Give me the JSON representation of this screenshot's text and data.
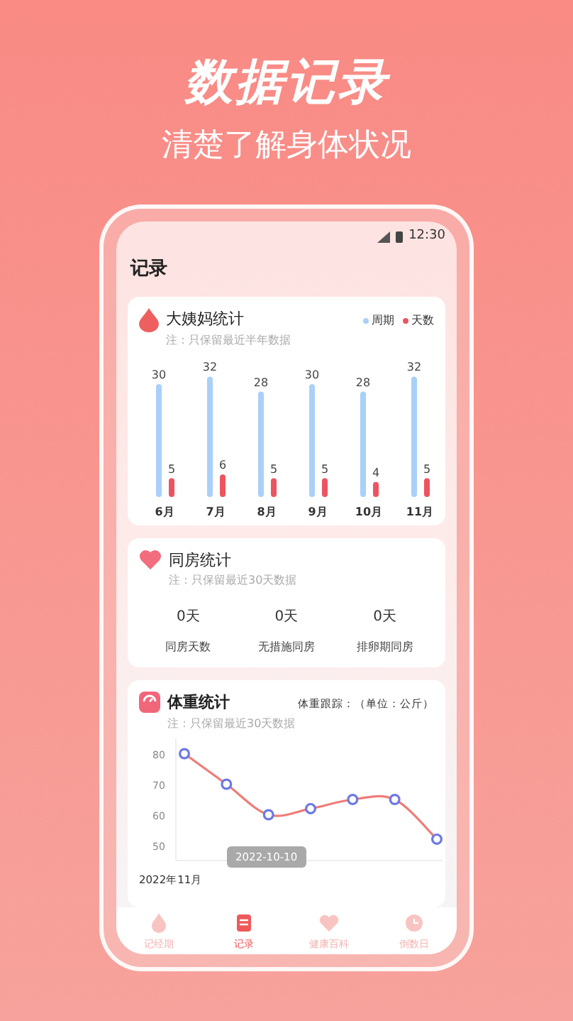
{
  "promo": {
    "headline": "数据记录",
    "subtitle": "清楚了解身体状况"
  },
  "status_bar": {
    "time": "12:30"
  },
  "page_title": "记录",
  "period_card": {
    "title": "大姨妈统计",
    "note": "注：只保留最近半年数据",
    "chart_data": {
      "type": "bar",
      "categories": [
        "6月",
        "7月",
        "8月",
        "9月",
        "10月",
        "11月"
      ],
      "data_labels": true,
      "series": [
        {
          "name": "周期",
          "color": "#a9d0f8",
          "values": [
            30,
            32,
            28,
            30,
            28,
            32
          ]
        },
        {
          "name": "天数",
          "color": "#ec5560",
          "values": [
            5,
            6,
            5,
            5,
            4,
            5
          ]
        }
      ]
    }
  },
  "intimacy_card": {
    "title": "同房统计",
    "note": "注：只保留最近30天数据",
    "stats": [
      {
        "value": "0天",
        "label": "同房天数"
      },
      {
        "value": "0天",
        "label": "无措施同房"
      },
      {
        "value": "0天",
        "label": "排卵期同房"
      }
    ]
  },
  "weight_card": {
    "title": "体重统计",
    "unit_note": "体重跟踪：（单位：公斤）",
    "note": "注：只保留最近30天数据",
    "tooltip": "2022-10-10",
    "month_label": "2022年11月",
    "chart_data": {
      "type": "line",
      "yticks": [
        50,
        60,
        70,
        80
      ],
      "ylim": [
        45,
        85
      ],
      "series": [
        {
          "color": "#f07c78",
          "marker": "circle",
          "values": [
            80,
            70,
            60,
            62,
            65,
            65,
            52
          ]
        }
      ]
    }
  },
  "tabs": [
    {
      "label": "记经期",
      "selected": false
    },
    {
      "label": "记录",
      "selected": true
    },
    {
      "label": "健康百科",
      "selected": false
    },
    {
      "label": "倒数日",
      "selected": false
    }
  ]
}
